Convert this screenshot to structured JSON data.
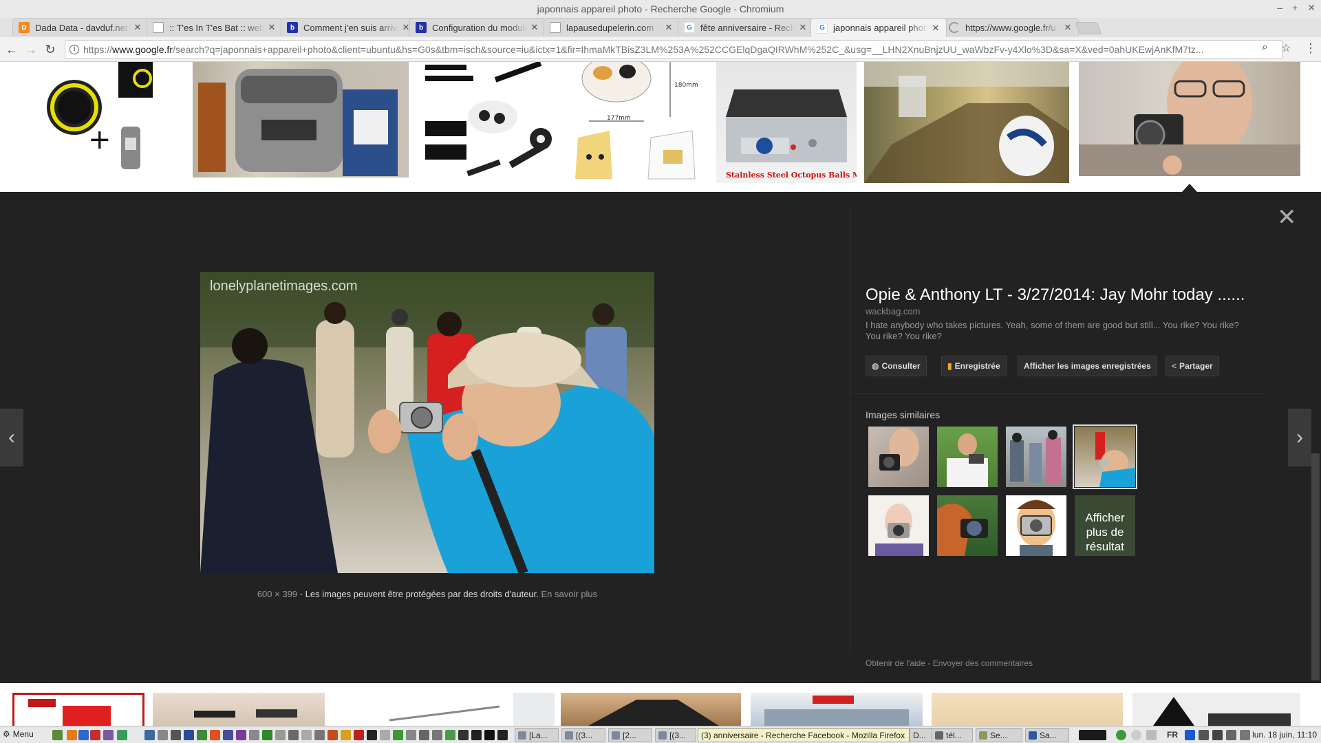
{
  "window": {
    "title": "japonnais appareil photo - Recherche Google - Chromium"
  },
  "tabs": [
    {
      "label": "Dada Data - davduf.net",
      "favicon": "d-letter-icon",
      "color": "#f08a24",
      "glyph": "D"
    },
    {
      "label": ":: T'es In T'es Bat :: webzine",
      "favicon": "page-icon",
      "color": "#ffffff",
      "glyph": ""
    },
    {
      "label": "Comment j'en suis arrivé",
      "favicon": "b-letter-icon",
      "color": "#2233aa",
      "glyph": "b"
    },
    {
      "label": "Configuration du module",
      "favicon": "b-letter-icon",
      "color": "#2233aa",
      "glyph": "b"
    },
    {
      "label": "lapausedupelerin.com",
      "favicon": "page-icon",
      "color": "#ffffff",
      "glyph": ""
    },
    {
      "label": "fête anniversaire - Recherche",
      "favicon": "google-g-icon",
      "color": "#4285f4",
      "glyph": "G"
    },
    {
      "label": "japonnais appareil photo",
      "favicon": "google-g-icon",
      "color": "#4285f4",
      "glyph": "G"
    },
    {
      "label": "https://www.google.fr/u",
      "favicon": "loading-icon",
      "color": "#999999",
      "glyph": ""
    }
  ],
  "toolbar": {
    "url_prefix": "https://",
    "url_host": "www.google.fr",
    "url_path": "/search?q=japonnais+appareil+photo&client=ubuntu&hs=G0s&tbm=isch&source=iu&ictx=1&fir=IhmaMkTBisZ3LM%253A%252CCGElqDgaQIRWhM%252C_&usg=__LHN2XnuBnjzUU_waWbzFv-y4Xlo%3D&sa=X&ved=0ahUKEwjAnKfM7tz..."
  },
  "preview": {
    "watermark": "lonelyplanetimages.com",
    "dimensions": "600 × 399",
    "sep": "-",
    "copyright": "Les images peuvent être protégées par des droits d'auteur.",
    "learn_more": "En savoir plus",
    "top_thumb_caption": "Stainless Steel Octopus Balls Maker"
  },
  "info": {
    "title": "Opie & Anthony LT - 3/27/2014: Jay Mohr today ......",
    "source": "wackbag.com",
    "description": "I hate anybody who takes pictures. Yeah, some of them are good but still... You rike? You rike? You rike? You rike?",
    "buttons": {
      "visit": "Consulter",
      "saved": "Enregistrée",
      "view_saved": "Afficher les images enregistrées",
      "share": "Partager"
    },
    "similar_title": "Images similaires",
    "more_results": "Afficher plus de résultat",
    "footer_help": "Obtenir de l'aide",
    "footer_sep": "-",
    "footer_feedback": "Envoyer des commentaires"
  },
  "taskbar": {
    "menu_label": "Menu",
    "windows": [
      {
        "label": "[La...",
        "active": false
      },
      {
        "label": "[(3...",
        "active": false
      },
      {
        "label": "[2...",
        "active": false
      },
      {
        "label": "[(3...",
        "active": false
      },
      {
        "label": "(3) anniversaire - Recherche Facebook - Mozilla Firefox",
        "active": true
      },
      {
        "label": "D...",
        "active": false
      },
      {
        "label": "tél...",
        "active": false
      },
      {
        "label": "Se...",
        "active": false
      },
      {
        "label": "Sa...",
        "active": false
      }
    ],
    "lang": "FR",
    "clock": "lun. 18 juin, 11:10"
  },
  "colors": {
    "panel_bg": "#222222",
    "accent_orange": "#f6a623",
    "chrome_bg": "#f2f2f2"
  }
}
